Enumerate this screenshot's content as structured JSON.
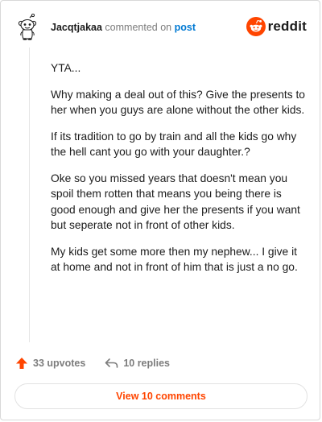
{
  "comment": {
    "author": "Jacqtjakaa",
    "action_text": "commented on",
    "target_link": "post",
    "paragraphs": [
      "YTA...",
      "Why making a deal out of this? Give the presents to her when you guys are alone without the other kids.",
      "If its tradition to go by train and all the kids go why the hell cant you go with your daughter.?",
      "Oke so you missed years that doesn't mean you spoil them rotten that means you being there is good enough and give her the presents if you want but seperate not in front of other kids.",
      "My kids get some more then my nephew... I give it at home and not in front of him that is just a no go."
    ]
  },
  "brand": {
    "name": "reddit",
    "icon": "reddit-snoo-icon",
    "color": "#ff4500"
  },
  "actions": {
    "upvotes_label": "33 upvotes",
    "upvote_icon": "upvote-arrow-icon",
    "replies_label": "10 replies",
    "reply_icon": "reply-arrow-icon"
  },
  "footer": {
    "view_comments_label": "View 10 comments"
  },
  "colors": {
    "accent": "#ff4500",
    "link": "#0079d3",
    "muted": "#7c7c7c",
    "text": "#1c1c1c"
  }
}
